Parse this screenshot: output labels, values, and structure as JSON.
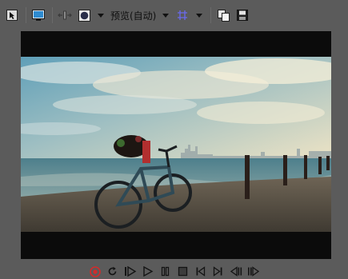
{
  "toolbar": {
    "preview_label": "预览(自动)",
    "icons": [
      "select-tool-icon",
      "monitor-icon",
      "split-view-icon",
      "overlay-circle-icon",
      "grid-icon",
      "copy-frame-icon",
      "save-frame-icon"
    ]
  },
  "transport": {
    "icons": [
      "record-icon",
      "loop-icon",
      "play-from-start-icon",
      "play-icon",
      "pause-icon",
      "stop-icon",
      "go-to-start-icon",
      "go-to-end-icon",
      "previous-frame-icon",
      "next-frame-icon"
    ]
  },
  "colors": {
    "background": "#5b5b5b",
    "preview_bg": "#0b0b0b",
    "record_accent": "#d22b2b",
    "grid_accent": "#6a6af0"
  }
}
